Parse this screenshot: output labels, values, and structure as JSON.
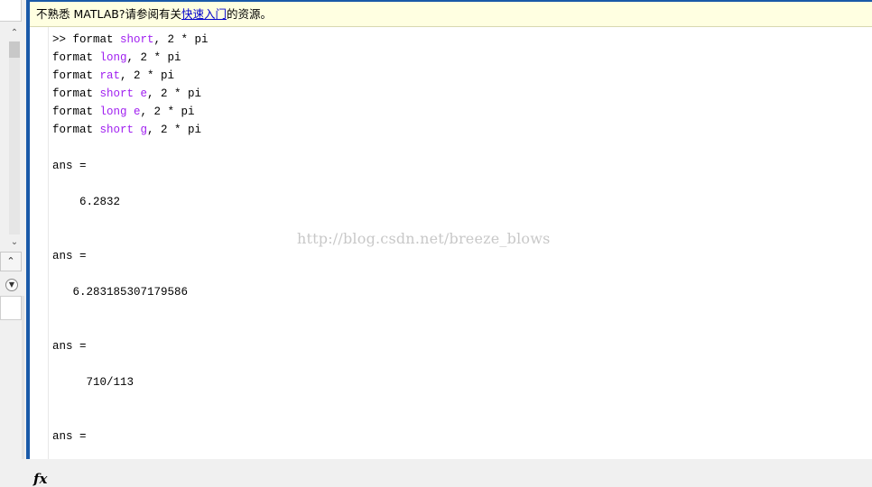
{
  "notice": {
    "before": "不熟悉 MATLAB?请参阅有关",
    "link": "快速入门",
    "after": "的资源。"
  },
  "commands": [
    {
      "pre": ">> format ",
      "kw": "short",
      "post": ", 2 * pi"
    },
    {
      "pre": "format ",
      "kw": "long",
      "post": ", 2 * pi"
    },
    {
      "pre": "format ",
      "kw": "rat",
      "post": ", 2 * pi"
    },
    {
      "pre": "format ",
      "kw": "short e",
      "post": ", 2 * pi"
    },
    {
      "pre": "format ",
      "kw": "long e",
      "post": ", 2 * pi"
    },
    {
      "pre": "format ",
      "kw": "short g",
      "post": ", 2 * pi"
    }
  ],
  "outputs": [
    {
      "label": "ans =",
      "value": "    6.2832"
    },
    {
      "label": "ans =",
      "value": "   6.283185307179586"
    },
    {
      "label": "ans =",
      "value": "     710/113"
    },
    {
      "label": "ans =",
      "value": ""
    }
  ],
  "watermark": "http://blog.csdn.net/breeze_blows",
  "fx_label": "fx",
  "icons": {
    "scroll_up": "chevron-up-icon",
    "scroll_down": "chevron-down-icon",
    "collapse": "chevron-up-icon",
    "menu": "dropdown-circle-icon"
  }
}
